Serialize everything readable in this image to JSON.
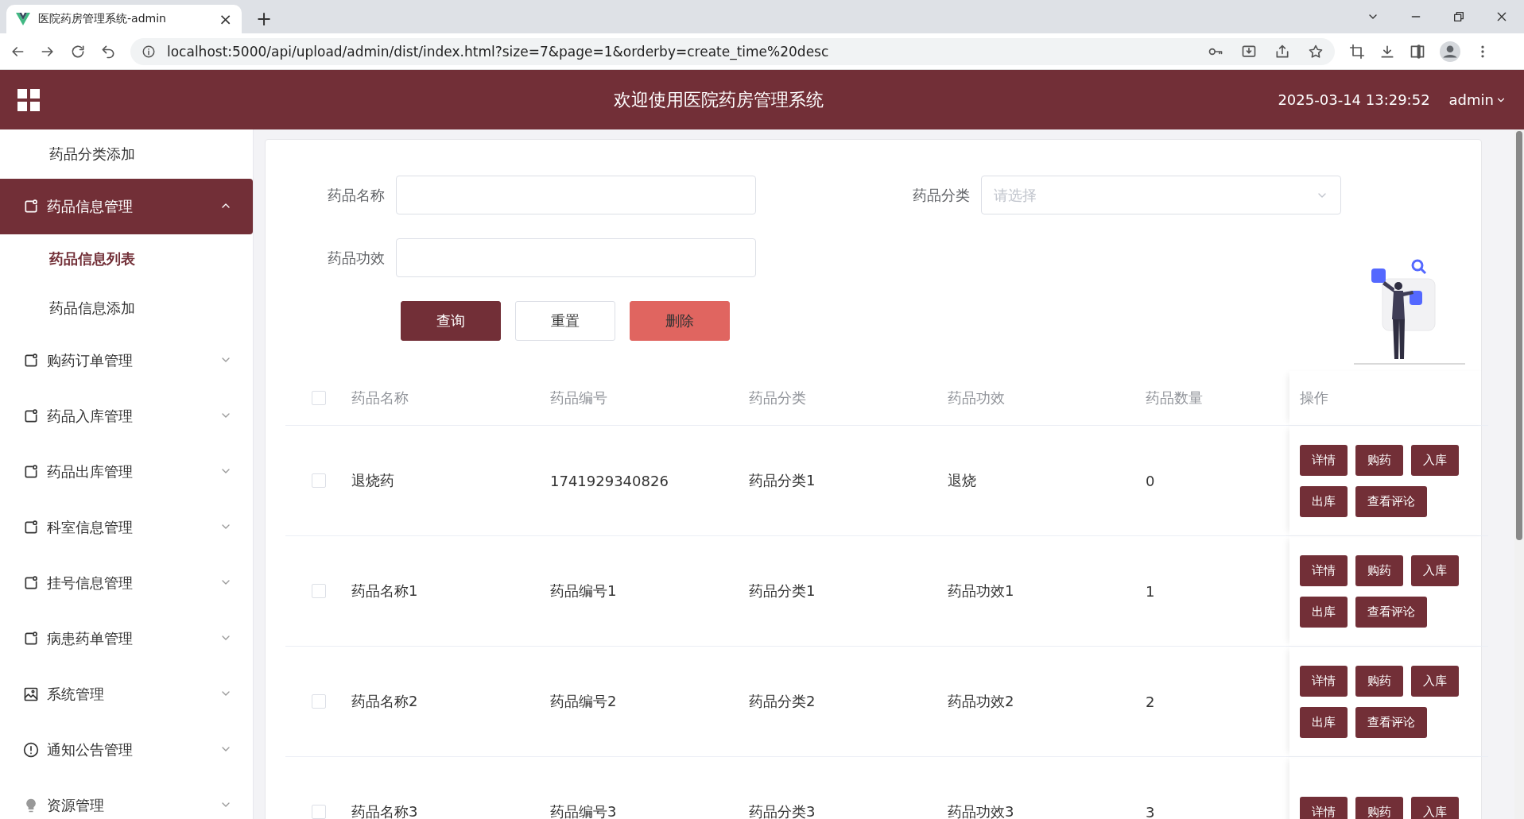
{
  "browser": {
    "tab_title": "医院药房管理系统-admin",
    "tab_close": "×",
    "new_tab": "+",
    "url": "localhost:5000/api/upload/admin/dist/index.html?size=7&page=1&orderby=create_time%20desc"
  },
  "header": {
    "title": "欢迎使用医院药房管理系统",
    "datetime": "2025-03-14 13:29:52",
    "user": "admin"
  },
  "sidebar": {
    "items": [
      {
        "label": "药品分类添加",
        "kind": "sub",
        "selected": false
      },
      {
        "label": "药品信息管理",
        "kind": "menu",
        "expanded": true
      },
      {
        "label": "药品信息列表",
        "kind": "sub",
        "selected": true
      },
      {
        "label": "药品信息添加",
        "kind": "sub",
        "selected": false
      },
      {
        "label": "购药订单管理",
        "kind": "menu",
        "expanded": false
      },
      {
        "label": "药品入库管理",
        "kind": "menu",
        "expanded": false
      },
      {
        "label": "药品出库管理",
        "kind": "menu",
        "expanded": false
      },
      {
        "label": "科室信息管理",
        "kind": "menu",
        "expanded": false
      },
      {
        "label": "挂号信息管理",
        "kind": "menu",
        "expanded": false
      },
      {
        "label": "病患药单管理",
        "kind": "menu",
        "expanded": false
      },
      {
        "label": "系统管理",
        "kind": "menu",
        "expanded": false
      },
      {
        "label": "通知公告管理",
        "kind": "menu",
        "expanded": false
      },
      {
        "label": "资源管理",
        "kind": "menu",
        "expanded": false
      }
    ]
  },
  "search": {
    "fields": [
      {
        "label": "药品名称",
        "kind": "input"
      },
      {
        "label": "药品分类",
        "kind": "select",
        "placeholder": "请选择"
      },
      {
        "label": "药品功效",
        "kind": "input"
      }
    ],
    "buttons": [
      {
        "label": "查询",
        "kind": "primary"
      },
      {
        "label": "重置",
        "kind": "default"
      },
      {
        "label": "删除",
        "kind": "danger"
      }
    ]
  },
  "table": {
    "select_all": false,
    "columns": [
      "药品名称",
      "药品编号",
      "药品分类",
      "药品功效",
      "药品数量",
      "操作"
    ],
    "rows": [
      {
        "checked": false,
        "cells": [
          "退烧药",
          "1741929340826",
          "药品分类1",
          "退烧",
          "0"
        ],
        "actions": [
          "详情",
          "购药",
          "入库",
          "出库",
          "查看评论"
        ]
      },
      {
        "checked": false,
        "cells": [
          "药品名称1",
          "药品编号1",
          "药品分类1",
          "药品功效1",
          "1"
        ],
        "actions": [
          "详情",
          "购药",
          "入库",
          "出库",
          "查看评论"
        ]
      },
      {
        "checked": false,
        "cells": [
          "药品名称2",
          "药品编号2",
          "药品分类2",
          "药品功效2",
          "2"
        ],
        "actions": [
          "详情",
          "购药",
          "入库",
          "出库",
          "查看评论"
        ]
      },
      {
        "checked": false,
        "cells": [
          "药品名称3",
          "药品编号3",
          "药品分类3",
          "药品功效3",
          "3"
        ],
        "actions": [
          "详情",
          "购药",
          "入库"
        ]
      }
    ]
  }
}
